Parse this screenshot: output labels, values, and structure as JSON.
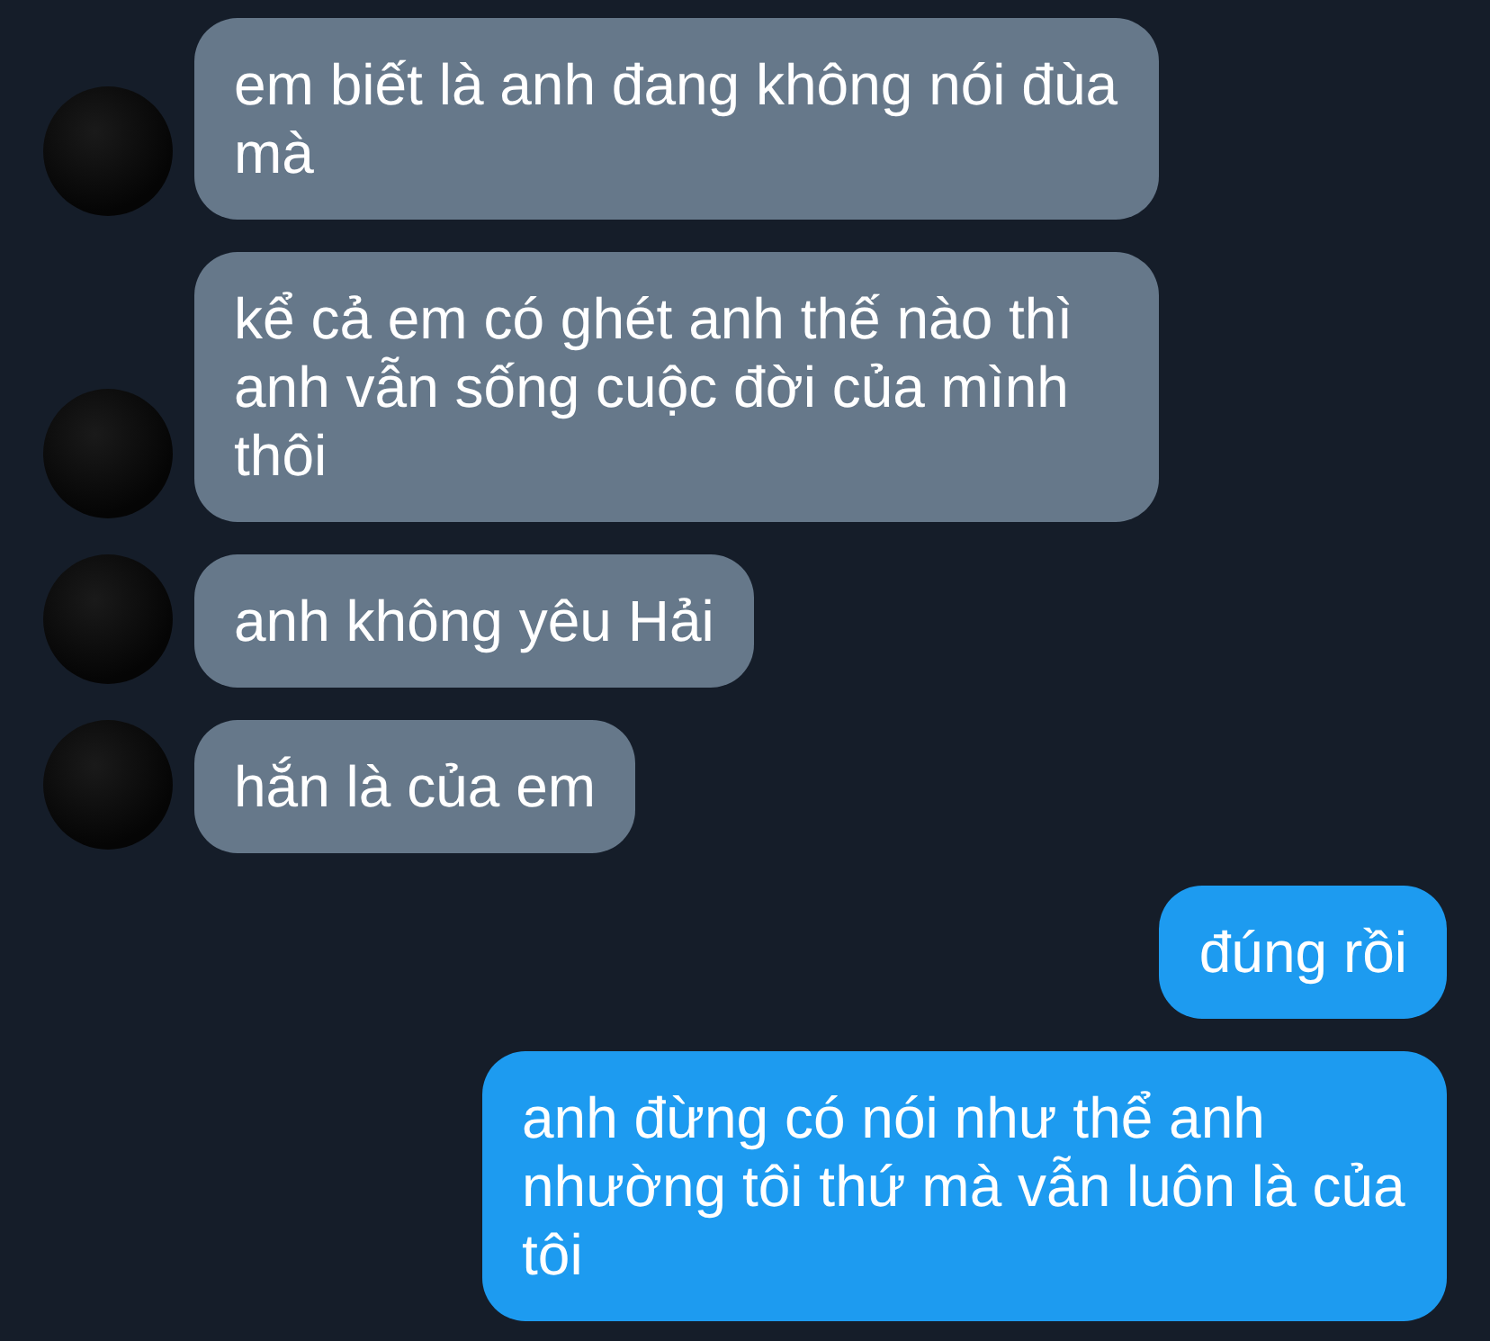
{
  "messages": [
    {
      "kind": "incoming",
      "text": "em biết là anh đang không nói đùa mà"
    },
    {
      "kind": "incoming",
      "text": "kể cả em có ghét anh thế nào thì anh vẫn sống cuộc đời của mình thôi"
    },
    {
      "kind": "incoming",
      "text": "anh không yêu Hải"
    },
    {
      "kind": "incoming",
      "text": "hắn là của em"
    },
    {
      "kind": "outgoing",
      "text": "đúng rồi"
    },
    {
      "kind": "outgoing",
      "text": "anh đừng có nói như thể anh nhường tôi thứ mà vẫn luôn là của tôi"
    }
  ]
}
